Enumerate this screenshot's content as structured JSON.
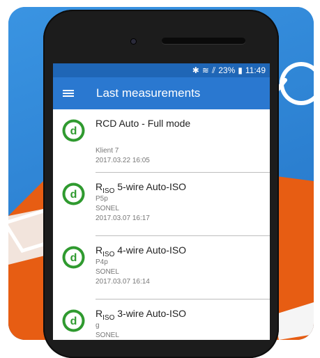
{
  "status_bar": {
    "bluetooth": "✱",
    "wifi": "≋",
    "signal": "⫽",
    "battery_pct": "23%",
    "battery": "▮",
    "time": "11:49"
  },
  "app_bar": {
    "title": "Last measurements"
  },
  "items": [
    {
      "title": "RCD Auto - Full mode",
      "line1": "",
      "line2": "Klient 7",
      "line3": "2017.03.22 16:05"
    },
    {
      "title_prefix": "R",
      "title_sub": "ISO",
      "title_suffix": " 5-wire Auto-ISO",
      "line1": "P5p",
      "line2": "SONEL",
      "line3": "2017.03.07 16:17"
    },
    {
      "title_prefix": "R",
      "title_sub": "ISO",
      "title_suffix": " 4-wire Auto-ISO",
      "line1": "P4p",
      "line2": "SONEL",
      "line3": "2017.03.07 16:14"
    },
    {
      "title_prefix": "R",
      "title_sub": "ISO",
      "title_suffix": " 3-wire Auto-ISO",
      "line1": "g",
      "line2": "SONEL",
      "line3": ""
    }
  ],
  "colors": {
    "app_bar": "#2a78d0",
    "status_bar": "#1f66b6",
    "logo_green": "#2f9a2f",
    "bg_blue": "#2f86d6",
    "bg_orange": "#e75d13"
  }
}
